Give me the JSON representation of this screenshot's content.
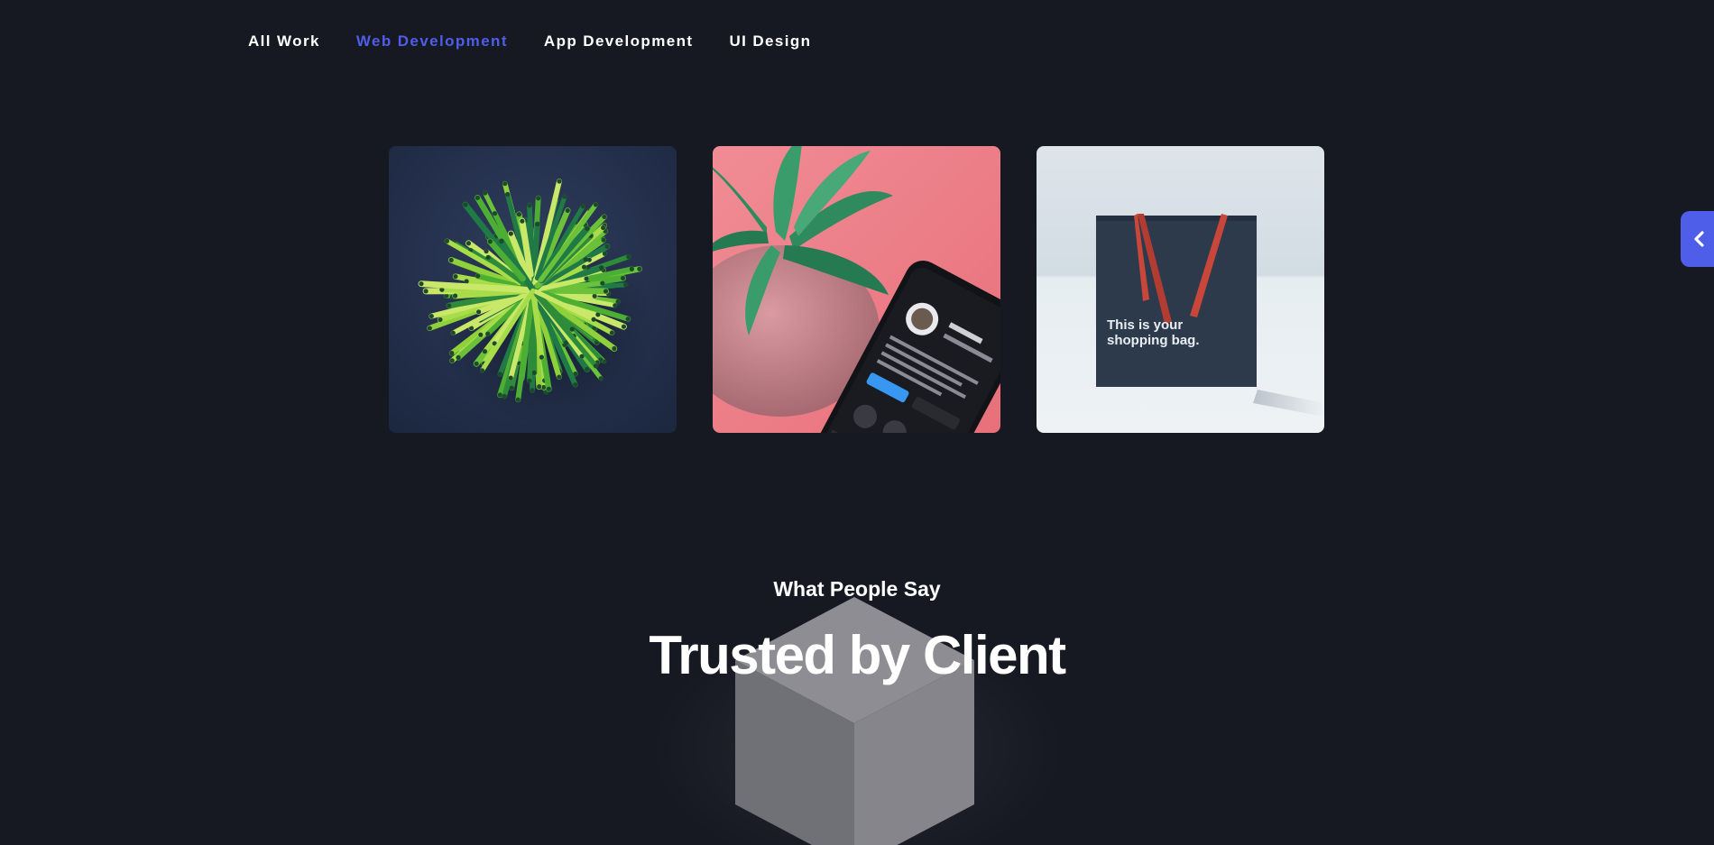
{
  "filters": [
    {
      "label": "All Work",
      "active": false
    },
    {
      "label": "Web Development",
      "active": true
    },
    {
      "label": "App Development",
      "active": false
    },
    {
      "label": "UI Design",
      "active": false
    }
  ],
  "gallery": {
    "items": [
      {
        "image": "green-straws-bundle-photo"
      },
      {
        "image": "plant-and-phone-photo"
      },
      {
        "image": "shopping-bag-photo",
        "bag_text_line1": "This is your",
        "bag_text_line2": "shopping bag."
      }
    ]
  },
  "side_toggle": {
    "icon": "chevron-left-icon"
  },
  "testimonials": {
    "eyebrow": "What People Say",
    "title": "Trusted by Client"
  },
  "colors": {
    "background": "#171922",
    "accent": "#4f5ee8",
    "text": "#ffffff"
  }
}
